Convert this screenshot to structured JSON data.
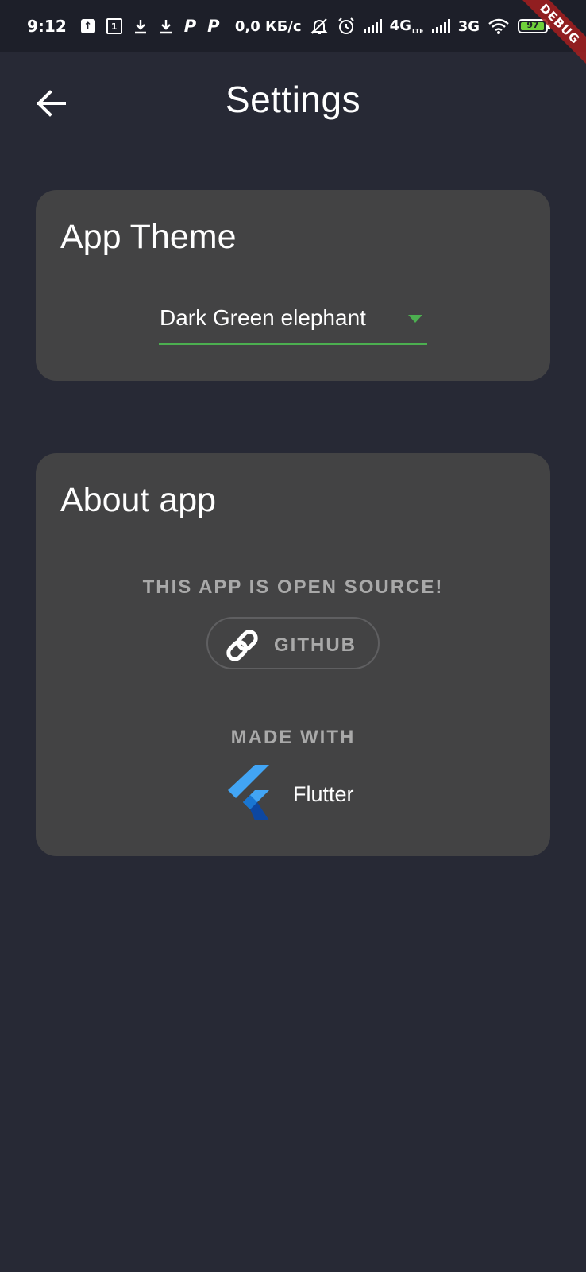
{
  "status_bar": {
    "time": "9:12",
    "notif_box_label": "1",
    "p_label": "P",
    "speed": "0,0 КБ/с",
    "network_1": "4G",
    "network_1_sub": "LTE",
    "network_2": "3G",
    "battery_level": "97",
    "battery_fraction": 0.97
  },
  "debug_banner": "DEBUG",
  "app_bar": {
    "title": "Settings",
    "back_icon": "arrow-back-icon"
  },
  "theme_card": {
    "title": "App Theme",
    "dropdown_value": "Dark Green elephant",
    "accent_color": "#4caf50"
  },
  "about_card": {
    "title": "About app",
    "open_source_text": "THIS APP IS OPEN SOURCE!",
    "github_label": "GITHUB",
    "github_icon": "link-icon",
    "made_with_text": "MADE WITH",
    "flutter_label": "Flutter",
    "flutter_icon": "flutter-logo-icon"
  },
  "colors": {
    "background": "#272935",
    "status_bar": "#1d1f29",
    "card": "#434344",
    "muted_text": "#a9a9a9",
    "debug_red": "#a61e1e"
  }
}
